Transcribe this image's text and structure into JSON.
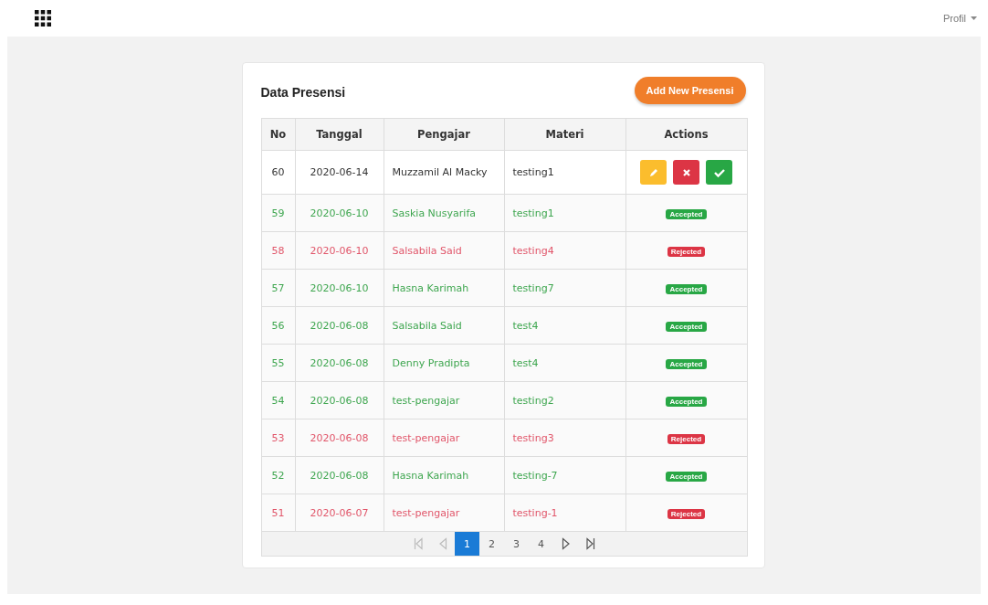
{
  "topbar": {
    "profile": "Profil"
  },
  "card": {
    "title": "Data Presensi",
    "add_button": "Add New Presensi"
  },
  "table": {
    "columns": [
      "No",
      "Tanggal",
      "Pengajar",
      "Materi",
      "Actions"
    ],
    "rows": [
      {
        "no": "60",
        "tanggal": "2020-06-14",
        "pengajar": "Muzzamil Al Macky",
        "materi": "testing1",
        "kind": "pending"
      },
      {
        "no": "59",
        "tanggal": "2020-06-10",
        "pengajar": "Saskia Nusyarifa",
        "materi": "testing1",
        "kind": "accepted",
        "badge": "Accepted"
      },
      {
        "no": "58",
        "tanggal": "2020-06-10",
        "pengajar": "Salsabila Said",
        "materi": "testing4",
        "kind": "rejected",
        "badge": "Rejected"
      },
      {
        "no": "57",
        "tanggal": "2020-06-10",
        "pengajar": "Hasna Karimah",
        "materi": "testing7",
        "kind": "accepted",
        "badge": "Accepted"
      },
      {
        "no": "56",
        "tanggal": "2020-06-08",
        "pengajar": "Salsabila Said",
        "materi": "test4",
        "kind": "accepted",
        "badge": "Accepted"
      },
      {
        "no": "55",
        "tanggal": "2020-06-08",
        "pengajar": "Denny Pradipta",
        "materi": "test4",
        "kind": "accepted",
        "badge": "Accepted"
      },
      {
        "no": "54",
        "tanggal": "2020-06-08",
        "pengajar": "test-pengajar",
        "materi": "testing2",
        "kind": "accepted",
        "badge": "Accepted"
      },
      {
        "no": "53",
        "tanggal": "2020-06-08",
        "pengajar": "test-pengajar",
        "materi": "testing3",
        "kind": "rejected",
        "badge": "Rejected"
      },
      {
        "no": "52",
        "tanggal": "2020-06-08",
        "pengajar": "Hasna Karimah",
        "materi": "testing-7",
        "kind": "accepted",
        "badge": "Accepted"
      },
      {
        "no": "51",
        "tanggal": "2020-06-07",
        "pengajar": "test-pengajar",
        "materi": "testing-1",
        "kind": "rejected",
        "badge": "Rejected"
      }
    ]
  },
  "pagination": {
    "first_disabled": true,
    "prev_disabled": true,
    "pages": [
      {
        "label": "1",
        "selected": true
      },
      {
        "label": "2",
        "selected": false
      },
      {
        "label": "3",
        "selected": false
      },
      {
        "label": "4",
        "selected": false
      }
    ]
  }
}
